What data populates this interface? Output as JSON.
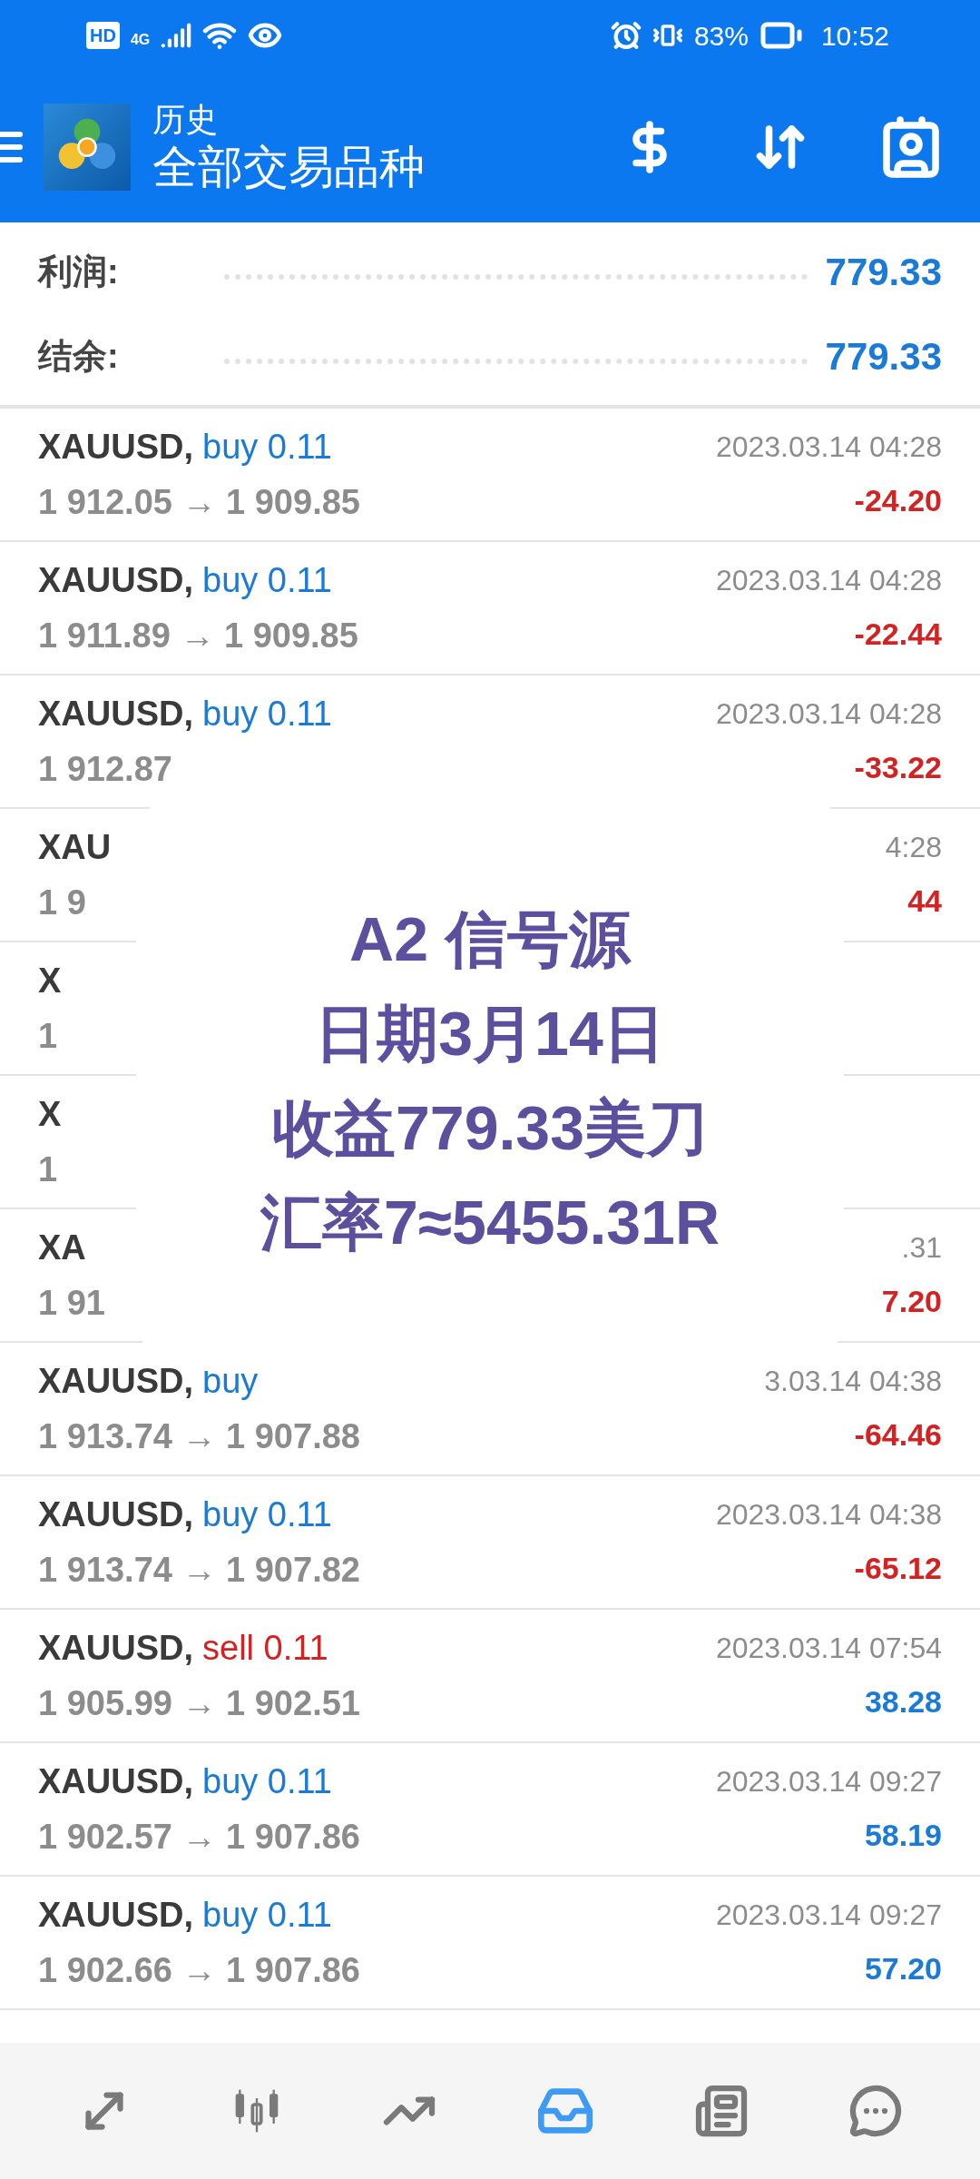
{
  "status_bar": {
    "hd": "HD",
    "network": "4G",
    "battery": "83%",
    "time": "10:52"
  },
  "header": {
    "title": "历史",
    "subtitle": "全部交易品种"
  },
  "summary": [
    {
      "label": "利润:",
      "value": "779.33"
    },
    {
      "label": "结余:",
      "value": "779.33"
    }
  ],
  "trades": [
    {
      "symbol": "XAUUSD,",
      "side": "buy 0.11",
      "kind": "buy",
      "prices": "1 912.05 → 1 909.85",
      "time": "2023.03.14 04:28",
      "profit": "-24.20",
      "loss": true
    },
    {
      "symbol": "XAUUSD,",
      "side": "buy 0.11",
      "kind": "buy",
      "prices": "1 911.89 → 1 909.85",
      "time": "2023.03.14 04:28",
      "profit": "-22.44",
      "loss": true
    },
    {
      "symbol": "XAUUSD,",
      "side": "buy 0.11",
      "kind": "buy",
      "prices": "1 912.87",
      "time": "2023.03.14 04:28",
      "profit": "-33.22",
      "loss": true
    },
    {
      "symbol": "XAU",
      "prices": "1 9",
      "time": "4:28",
      "profit": "44",
      "loss": true
    },
    {
      "symbol": "X",
      "prices": "1"
    },
    {
      "symbol": "X",
      "prices": "1"
    },
    {
      "symbol": "XA",
      "prices": "1 91",
      "time": ".31",
      "profit": "7.20",
      "loss": true
    },
    {
      "symbol": "XAUUSD,",
      "side": "buy",
      "kind": "buy",
      "prices": "1 913.74 → 1 907.88",
      "time": "3.03.14 04:38",
      "profit": "-64.46",
      "loss": true
    },
    {
      "symbol": "XAUUSD,",
      "side": "buy 0.11",
      "kind": "buy",
      "prices": "1 913.74 → 1 907.82",
      "time": "2023.03.14 04:38",
      "profit": "-65.12",
      "loss": true
    },
    {
      "symbol": "XAUUSD,",
      "side": "sell 0.11",
      "kind": "sell",
      "prices": "1 905.99 → 1 902.51",
      "time": "2023.03.14 07:54",
      "profit": "38.28",
      "loss": false
    },
    {
      "symbol": "XAUUSD,",
      "side": "buy 0.11",
      "kind": "buy",
      "prices": "1 902.57 → 1 907.86",
      "time": "2023.03.14 09:27",
      "profit": "58.19",
      "loss": false
    },
    {
      "symbol": "XAUUSD,",
      "side": "buy 0.11",
      "kind": "buy",
      "prices": "1 902.66 → 1 907.86",
      "time": "2023.03.14 09:27",
      "profit": "57.20",
      "loss": false
    }
  ],
  "annotation": {
    "lines": [
      "A2 信号源",
      "日期3月14日",
      "收益779.33美刀",
      "汇率7≈5455.31R"
    ]
  },
  "bottom_nav": [
    {
      "kind": "trade",
      "selected": false
    },
    {
      "kind": "quotes",
      "selected": false
    },
    {
      "kind": "chart",
      "selected": false
    },
    {
      "kind": "history",
      "selected": true
    },
    {
      "kind": "news",
      "selected": false
    },
    {
      "kind": "chat",
      "selected": false
    }
  ]
}
